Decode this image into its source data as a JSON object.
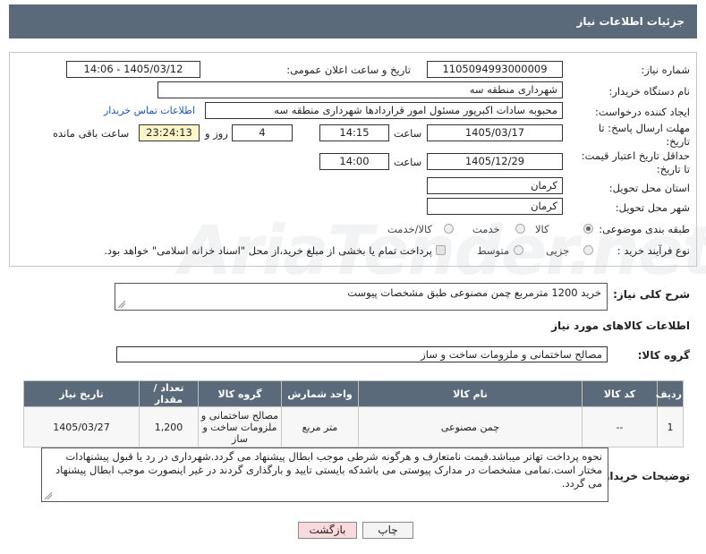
{
  "header": {
    "title": "جزئیات اطلاعات نیاز"
  },
  "fields": {
    "need_number": {
      "label": "شماره نیاز:",
      "value": "1105094993000009"
    },
    "announce_datetime": {
      "label": "تاریخ و ساعت اعلان عمومی:",
      "value": "1405/03/12 - 14:06"
    },
    "buyer_org": {
      "label": "نام دستگاه خریدار:",
      "value": "شهرداری منطقه سه"
    },
    "requester": {
      "label": "ایجاد کننده درخواست:",
      "value": "محبوبه سادات اکبرپور مسئول امور قراردادها شهرداری منطقه سه",
      "contact_link": "اطلاعات تماس خریدار"
    },
    "deadline": {
      "label_line1": "مهلت ارسال پاسخ: تا",
      "label_line2": "تاریخ:",
      "date": "1405/03/17",
      "time_label": "ساعت",
      "time": "14:15",
      "days": "4",
      "days_label": "روز و",
      "remaining": "23:24:13",
      "remaining_label": "ساعت باقی مانده"
    },
    "price_validity": {
      "label_line1": "حداقل تاریخ اعتبار قیمت:",
      "label_line2": "تا تاریخ:",
      "date": "1405/12/29",
      "time_label": "ساعت",
      "time": "14:00"
    },
    "province": {
      "label": "استان محل تحویل:",
      "value": "کرمان"
    },
    "city": {
      "label": "شهر محل تحویل:",
      "value": "کرمان"
    },
    "category": {
      "label": "طبقه بندی موضوعی:",
      "options": [
        "کالا",
        "خدمت",
        "کالا/خدمت"
      ],
      "selected": "کالا"
    },
    "purchase_type": {
      "label": "نوع فرآیند خرید :",
      "options": [
        "جزیی",
        "متوسط"
      ],
      "note": "پرداخت تمام یا بخشی از مبلغ خرید،از محل \"اسناد خزانه اسلامی\" خواهد بود."
    }
  },
  "summary": {
    "label": "شرح کلی نیاز:",
    "value": "خرید 1200 مترمربع چمن مصنوعی طبق مشخصات پیوست"
  },
  "goods_section": {
    "title": "اطلاعات کالاهای مورد نیاز",
    "group_label": "گروه کالا:",
    "group_value": "مصالح ساختمانی و ملزومات ساخت و ساز"
  },
  "table": {
    "headers": [
      "ردیف",
      "کد کالا",
      "نام کالا",
      "واحد شمارش",
      "گروه کالا",
      "تعداد / مقدار",
      "تاریخ نیاز"
    ],
    "rows": [
      {
        "row": "1",
        "code": "--",
        "name": "چمن مصنوعی",
        "unit": "متر مربع",
        "group": "مصالح ساختمانی و ملزومات ساخت و ساز",
        "qty": "1,200",
        "date": "1405/03/27"
      }
    ]
  },
  "buyer_notes": {
    "label": "توضیحات خریدار:",
    "value": "نحوه پرداخت تهاتر میباشد.قیمت نامتعارف و هرگونه شرطی موجب ابطال پیشنهاد می گردد.شهرداری در رد یا قبول پیشنهادات مختار است.تمامی مشخصات در مدارک پیوستی می باشدکه بایستی تایید و بارگذاری گردند در غیر اینصورت موجب ابطال پیشنهاد می گردد."
  },
  "buttons": {
    "print": "چاپ",
    "back": "بازگشت"
  },
  "watermark": "AriaTender.net"
}
